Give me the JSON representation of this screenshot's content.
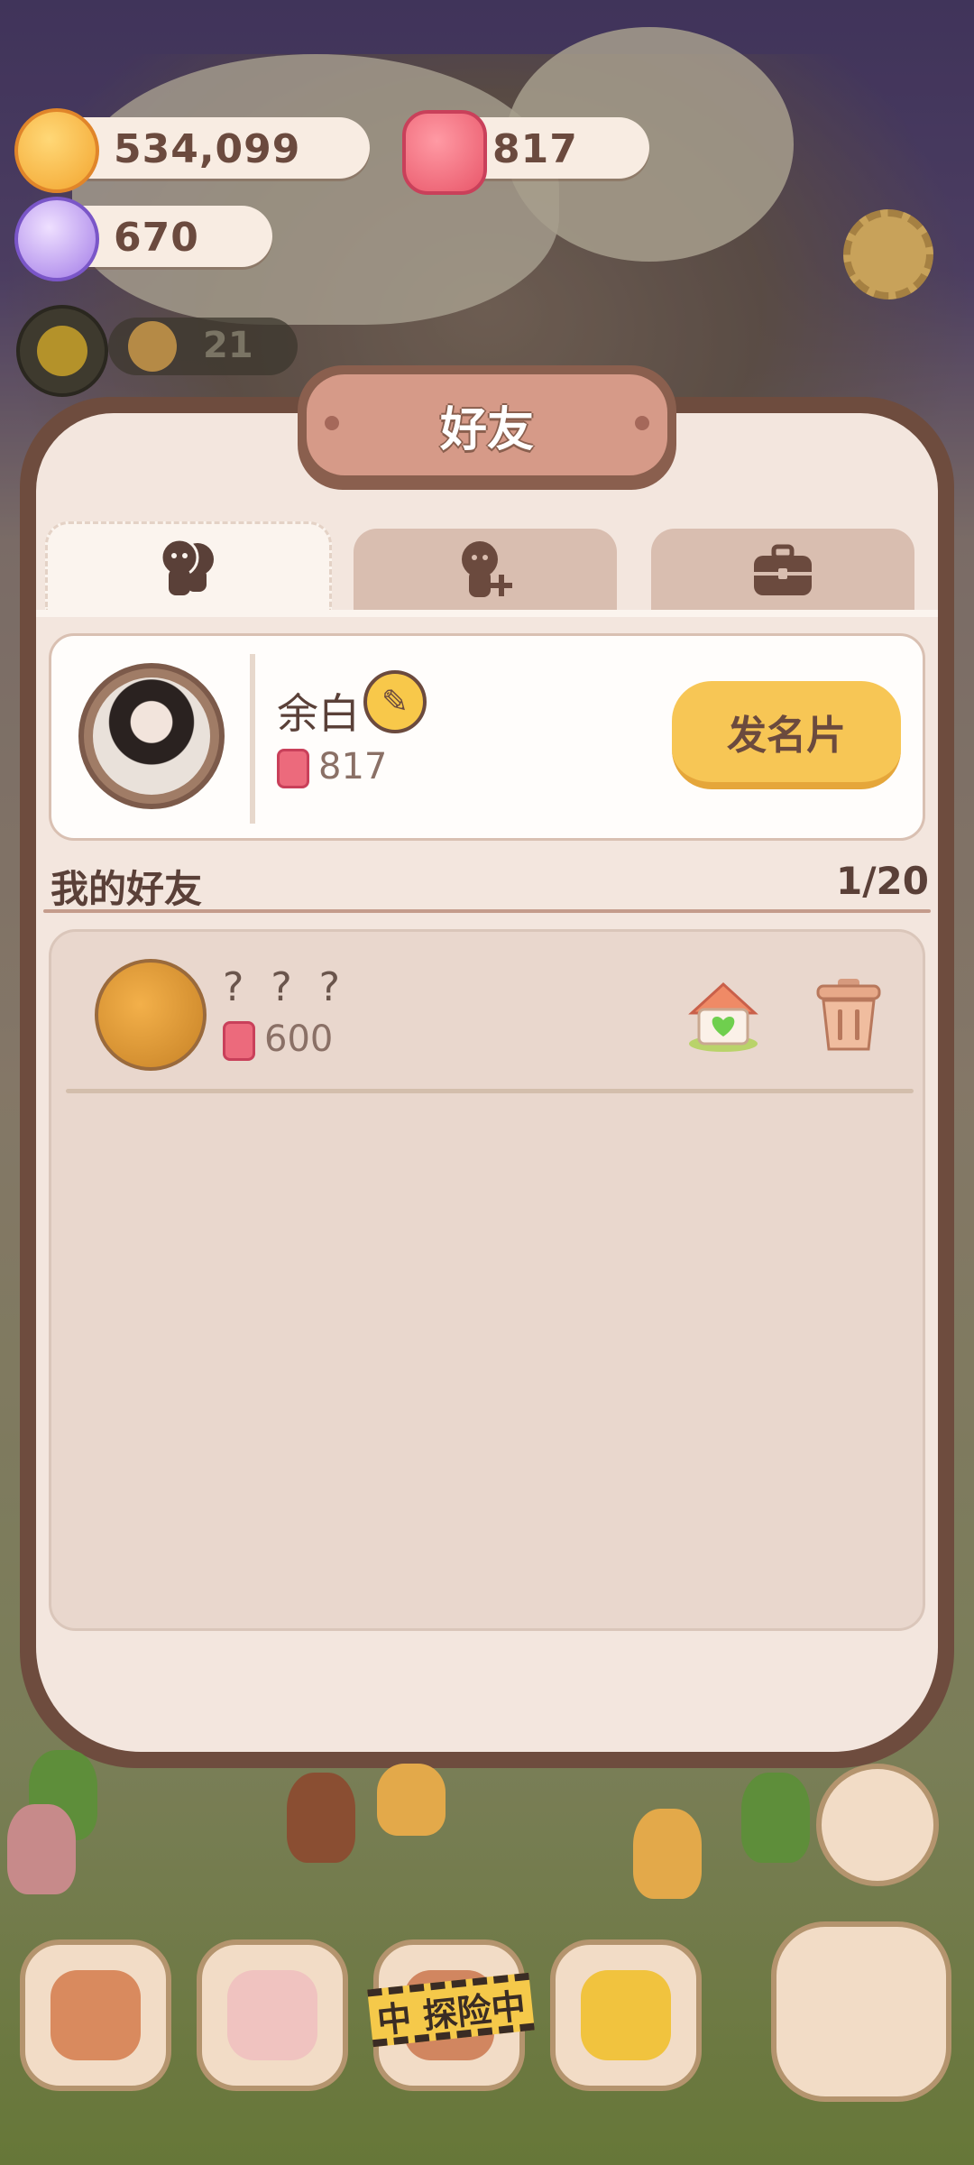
{
  "hud": {
    "coins": "534,099",
    "candles": "817",
    "candy": "670",
    "level_count": "21"
  },
  "dialog": {
    "title": "好友",
    "tabs": [
      {
        "name": "friends",
        "icon": "friends-icon",
        "active": true
      },
      {
        "name": "add-friend",
        "icon": "add-friend-icon",
        "active": false
      },
      {
        "name": "briefcase",
        "icon": "briefcase-icon",
        "active": false
      }
    ],
    "profile": {
      "name": "余白",
      "score": "817",
      "card_button": "发名片"
    },
    "friends_section": {
      "title": "我的好友",
      "count": "1/20"
    },
    "friends": [
      {
        "name": "? ? ?",
        "score": "600"
      }
    ]
  },
  "bottom_bar": {
    "explore_label": "中 探险中"
  },
  "colors": {
    "frame": "#6e4c3e",
    "panel": "#f3e6de",
    "accent_button": "#f7c655",
    "text": "#5a4038"
  }
}
